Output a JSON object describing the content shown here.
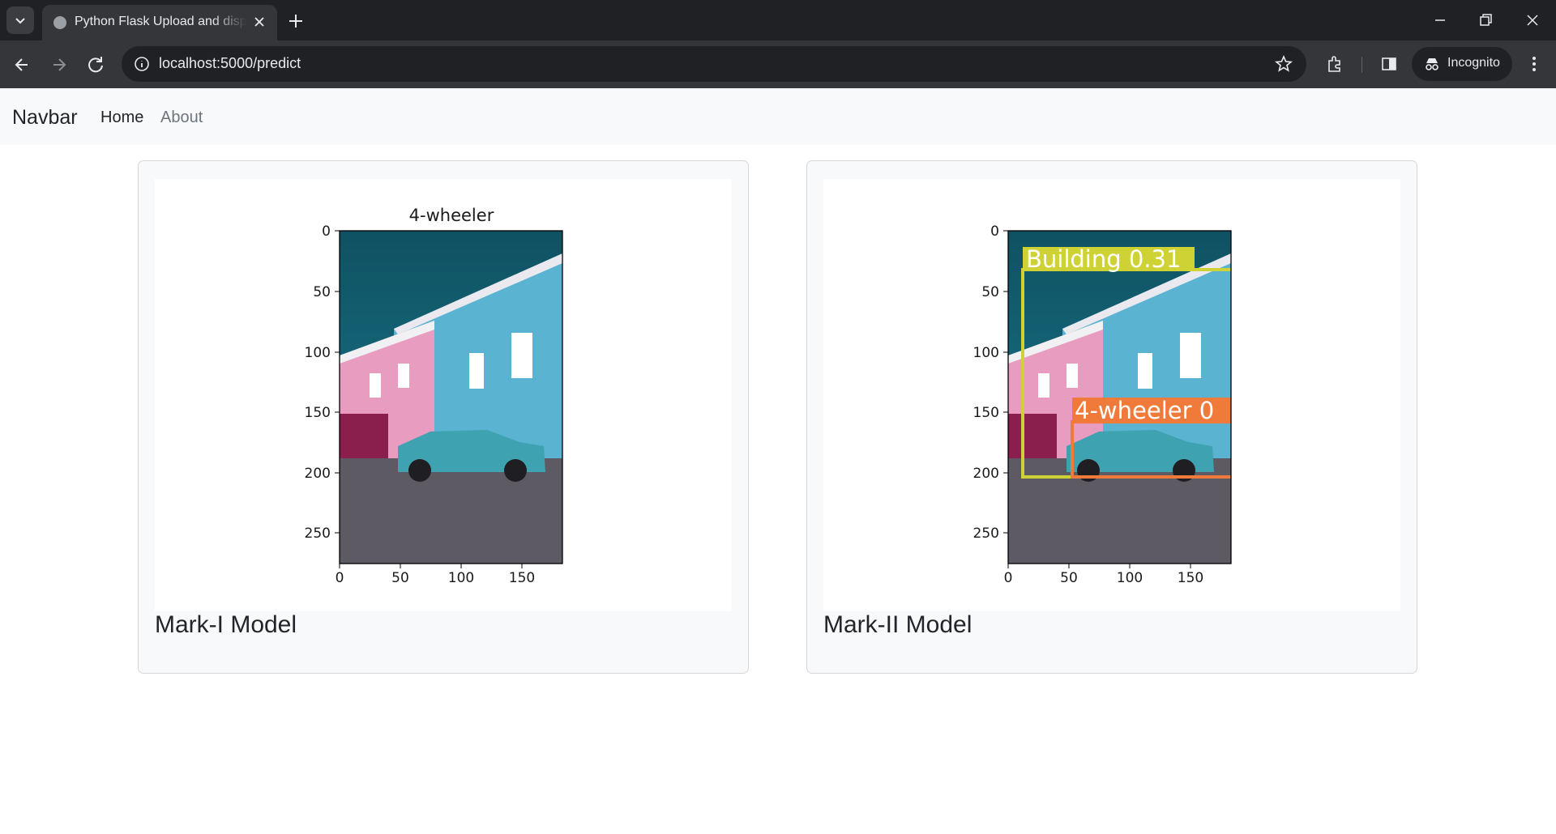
{
  "browser": {
    "tab_title": "Python Flask Upload and display image",
    "url": "localhost:5000/predict",
    "incognito_label": "Incognito",
    "accent": "#202124"
  },
  "navbar": {
    "brand": "Navbar",
    "links": [
      {
        "label": "Home",
        "active": true
      },
      {
        "label": "About",
        "active": false
      }
    ]
  },
  "cards": [
    {
      "title": "Mark-I Model",
      "plot_title": "4-wheeler",
      "x_ticks": [
        "0",
        "50",
        "100",
        "150"
      ],
      "y_ticks": [
        "0",
        "50",
        "100",
        "150",
        "200",
        "250"
      ],
      "detections": []
    },
    {
      "title": "Mark-II Model",
      "plot_title": "",
      "x_ticks": [
        "0",
        "50",
        "100",
        "150"
      ],
      "y_ticks": [
        "0",
        "50",
        "100",
        "150",
        "200",
        "250"
      ],
      "detections": [
        {
          "label": "Building 0.31",
          "color": "#cfd235"
        },
        {
          "label": "4-wheeler 0",
          "color": "#f07a3a"
        }
      ]
    }
  ]
}
